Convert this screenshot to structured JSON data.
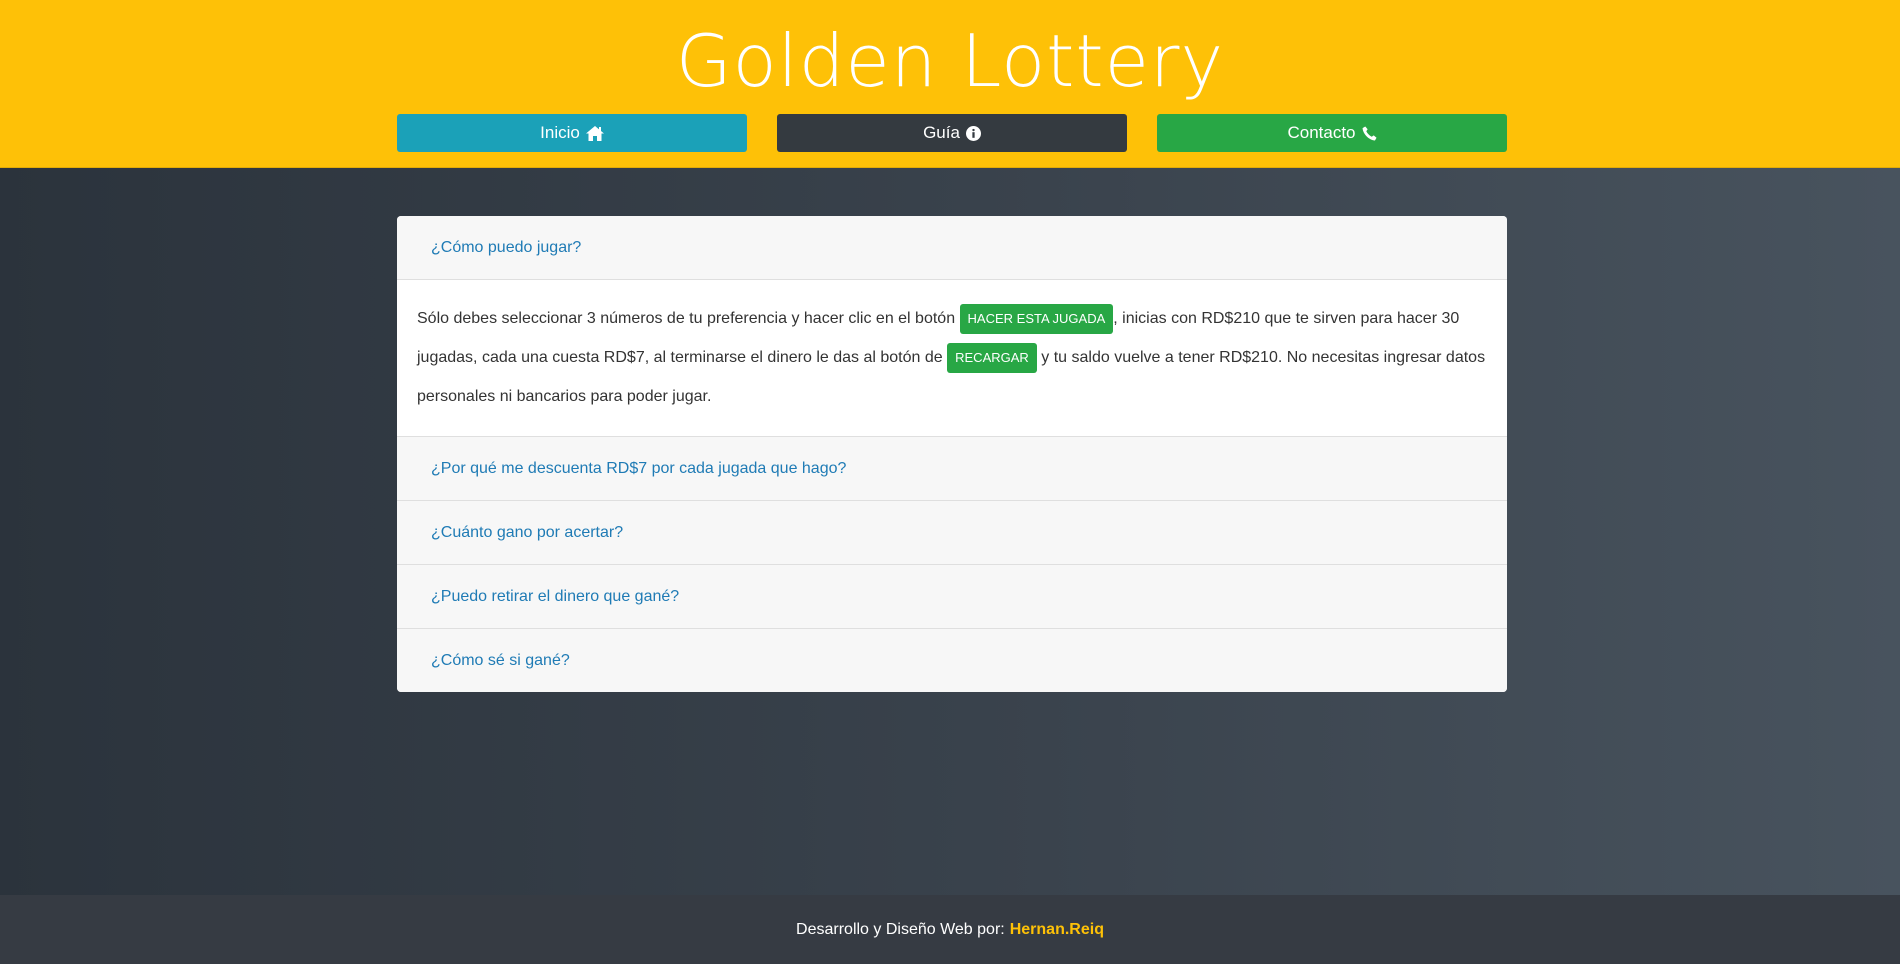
{
  "header": {
    "title": "Golden Lottery",
    "nav": [
      {
        "label": "Inicio",
        "icon": "home-icon",
        "color": "#1ba1b8"
      },
      {
        "label": "Guía",
        "icon": "info-circle-icon",
        "color": "#343a40"
      },
      {
        "label": "Contacto",
        "icon": "phone-icon",
        "color": "#28a745"
      }
    ],
    "background": "#fec107"
  },
  "faq": {
    "items": [
      {
        "question": "¿Cómo puedo jugar?",
        "expanded": true,
        "answer": {
          "part1": "Sólo debes seleccionar 3 números de tu preferencia y hacer clic en el botón",
          "button1": "HACER ESTA JUGADA",
          "part2": ", inicias con RD$210 que te sirven para hacer 30 jugadas, cada una cuesta RD$7, al terminarse el dinero le das al botón de",
          "button2": "RECARGAR",
          "part3": "y tu saldo vuelve a tener RD$210. No necesitas ingresar datos personales ni bancarios para poder jugar."
        }
      },
      {
        "question": "¿Por qué me descuenta RD$7 por cada jugada que hago?",
        "expanded": false
      },
      {
        "question": "¿Cuánto gano por acertar?",
        "expanded": false
      },
      {
        "question": "¿Puedo retirar el dinero que gané?",
        "expanded": false
      },
      {
        "question": "¿Cómo sé si gané?",
        "expanded": false
      }
    ]
  },
  "footer": {
    "text": "Desarrollo y Diseño Web por:",
    "author": "Hernan.Reiq"
  }
}
